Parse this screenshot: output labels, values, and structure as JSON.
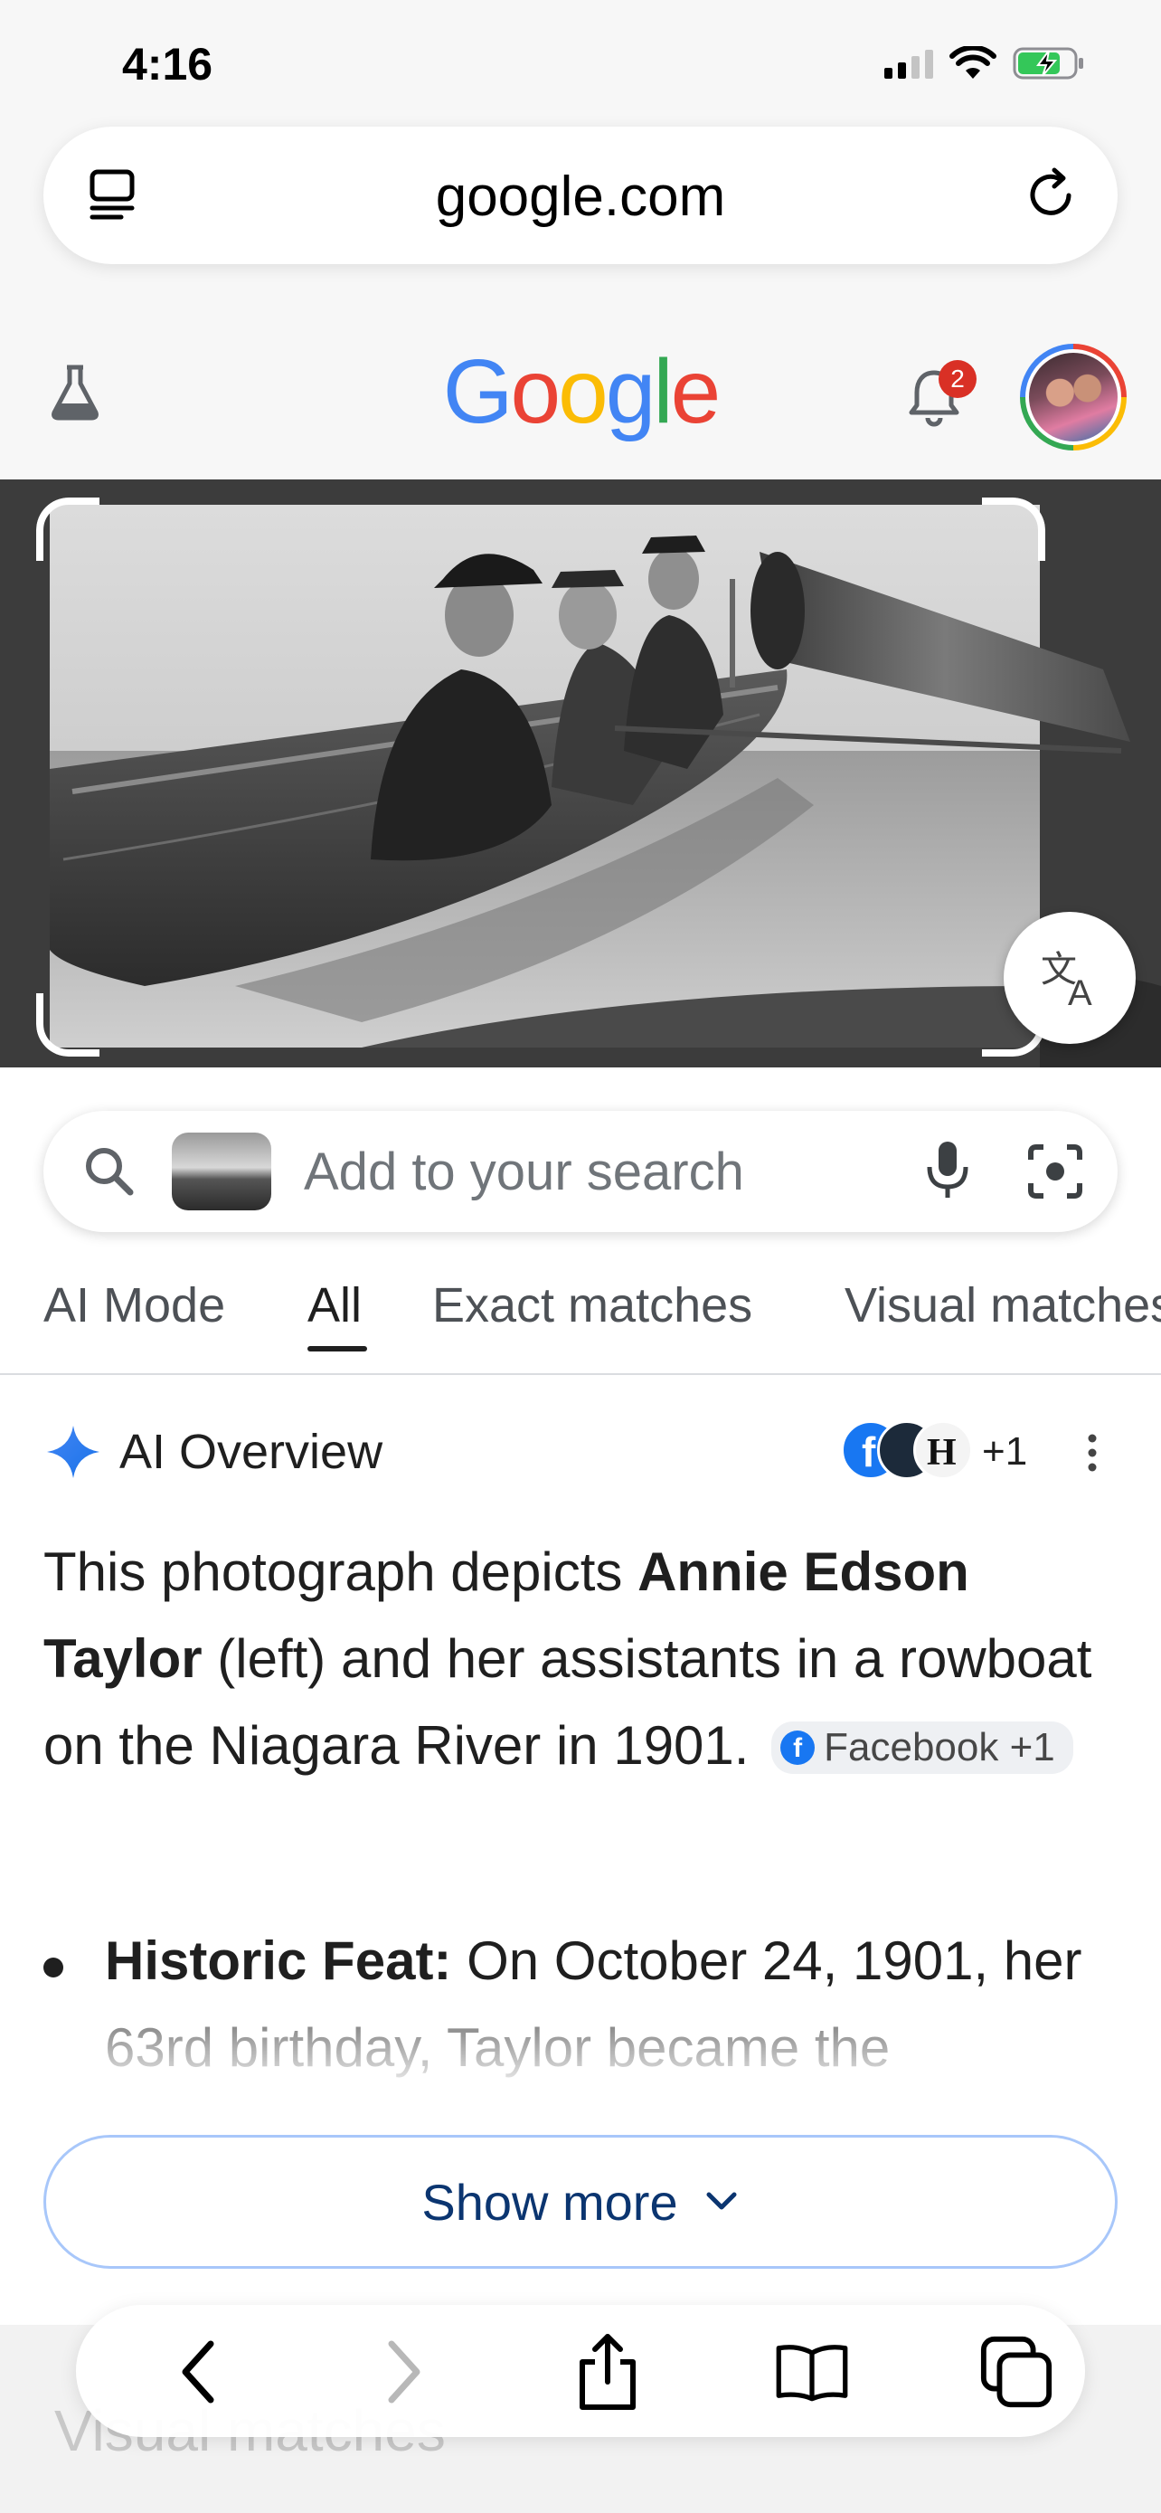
{
  "status_bar": {
    "time": "4:16"
  },
  "browser": {
    "url": "google.com",
    "url_left_icon": "reader-icon",
    "url_right_icon": "reload-icon"
  },
  "header": {
    "logo_letters": [
      "G",
      "o",
      "o",
      "g",
      "l",
      "e"
    ],
    "logo_colors": [
      "#4285f4",
      "#ea4335",
      "#fbbc05",
      "#4285f4",
      "#34a853",
      "#ea4335"
    ],
    "notification_count": "2"
  },
  "image": {
    "description_icon": "translate-icon"
  },
  "search": {
    "placeholder": "Add to your search"
  },
  "tabs": [
    {
      "label": "AI Mode"
    },
    {
      "label": "All"
    },
    {
      "label": "Exact matches"
    },
    {
      "label": "Visual matches"
    }
  ],
  "active_tab": "All",
  "ai_overview": {
    "title": "AI Overview",
    "source_count": "+1",
    "para_1": "This photograph depicts ",
    "para_bold": "Annie Edson Taylor",
    "para_2": " (left) and her assistants in a rowboat on the Niagara River in 1901.",
    "chip_label": "Facebook +1",
    "bullet_label": "Historic Feat:",
    "bullet_text": " On October 24, 1901, her 63rd birthday, Taylor became the"
  },
  "show_more": {
    "label": "Show more"
  },
  "next_section": {
    "heading": "Visual matches"
  },
  "colors": {
    "accent_blue": "#1a73e8",
    "show_more_text": "#0b3570",
    "badge_red": "#d93025"
  }
}
